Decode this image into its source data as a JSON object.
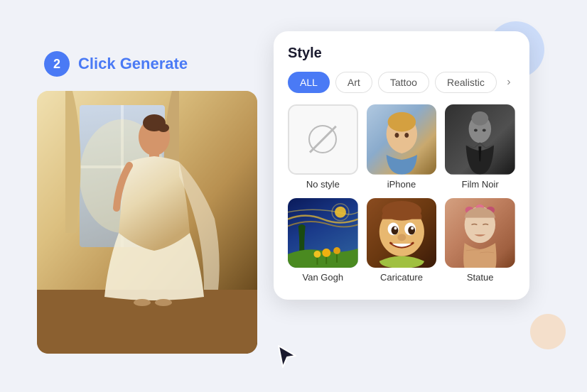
{
  "step": {
    "number": "2",
    "label": "Click Generate"
  },
  "style_panel": {
    "title": "Style",
    "filters": [
      {
        "id": "all",
        "label": "ALL",
        "active": true
      },
      {
        "id": "art",
        "label": "Art",
        "active": false
      },
      {
        "id": "tattoo",
        "label": "Tattoo",
        "active": false
      },
      {
        "id": "realistic",
        "label": "Realistic",
        "active": false
      }
    ],
    "items": [
      {
        "id": "no-style",
        "name": "No style",
        "type": "empty"
      },
      {
        "id": "iphone",
        "name": "iPhone",
        "type": "iphone"
      },
      {
        "id": "film-noir",
        "name": "Film Noir",
        "type": "filmnoir"
      },
      {
        "id": "van-gogh",
        "name": "Van Gogh",
        "type": "vangogh"
      },
      {
        "id": "caricature",
        "name": "Caricature",
        "type": "caricature"
      },
      {
        "id": "statue",
        "name": "Statue",
        "type": "statue"
      }
    ]
  }
}
